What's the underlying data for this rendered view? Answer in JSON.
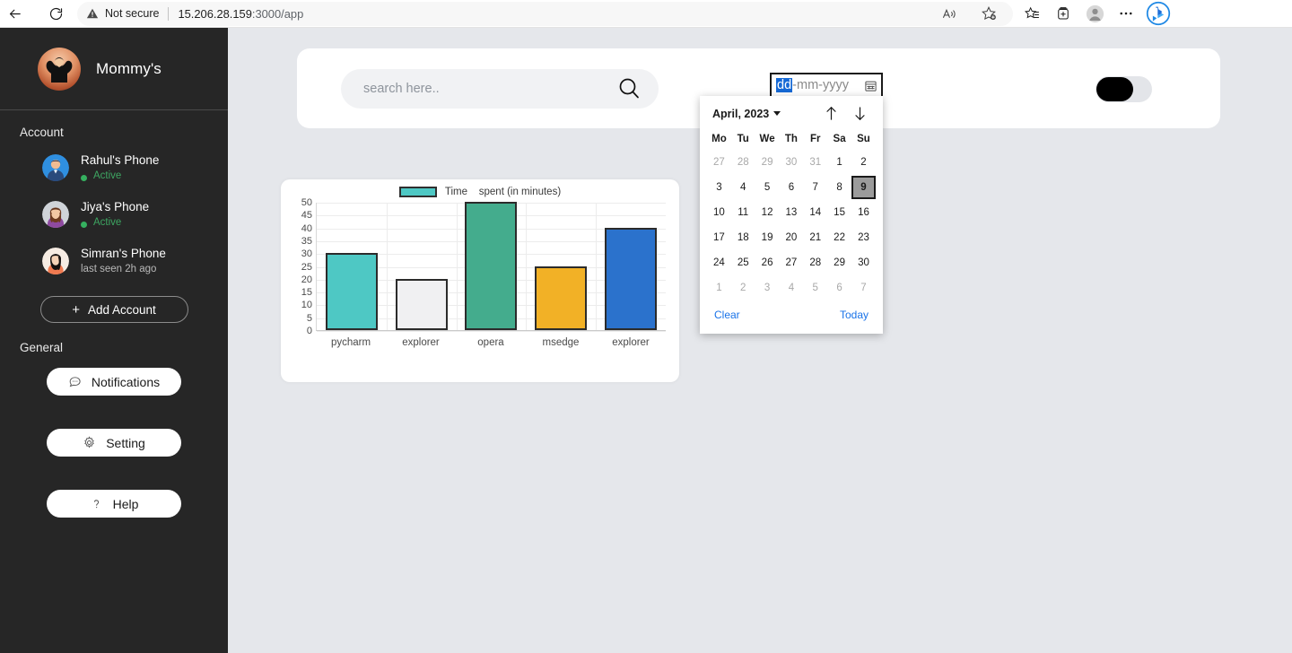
{
  "browser": {
    "back_label": "Back",
    "reload_label": "Refresh",
    "security_text": "Not secure",
    "url_host": "15.206.28.159",
    "url_path": ":3000/app",
    "icons": {
      "back": "back-arrow-icon",
      "reload": "reload-icon",
      "warning": "warning-triangle-icon",
      "read_aloud": "read-aloud-icon",
      "add_favorite": "add-favorite-icon",
      "favorites": "favorites-icon",
      "collections": "collections-icon",
      "profile": "profile-avatar-icon",
      "settings_more": "more-options-icon",
      "copilot": "bing-copilot-icon"
    }
  },
  "sidebar": {
    "brand_name": "Mommy's",
    "account_section_label": "Account",
    "accounts": [
      {
        "name": "Rahul's Phone",
        "status": "Active",
        "state": "active"
      },
      {
        "name": "Jiya's Phone",
        "status": "Active",
        "state": "active"
      },
      {
        "name": "Simran's Phone",
        "status": "last seen 2h ago",
        "state": "idle"
      }
    ],
    "add_account_label": "Add Account",
    "add_account_plus": "+",
    "general_section_label": "General",
    "general_items": [
      {
        "label": "Notifications",
        "icon": "chat-bubble-icon"
      },
      {
        "label": "Setting",
        "icon": "gear-icon"
      },
      {
        "label": "Help",
        "icon": "question-mark-icon"
      }
    ]
  },
  "topbar": {
    "search_placeholder": "search here..",
    "search_value": "",
    "date_input": {
      "segment_day": "dd",
      "separator1": "-",
      "segment_month": "mm",
      "separator2": "-",
      "segment_year": "yyyy",
      "calendar_icon": "calendar-icon"
    },
    "toggle_state": "off"
  },
  "datepicker": {
    "month_label": "April, 2023",
    "prev_label": "↑",
    "next_label": "↓",
    "day_headers": [
      "Mo",
      "Tu",
      "We",
      "Th",
      "Fr",
      "Sa",
      "Su"
    ],
    "weeks": [
      [
        {
          "d": "27",
          "m": true
        },
        {
          "d": "28",
          "m": true
        },
        {
          "d": "29",
          "m": true
        },
        {
          "d": "30",
          "m": true
        },
        {
          "d": "31",
          "m": true
        },
        {
          "d": "1",
          "m": false
        },
        {
          "d": "2",
          "m": false
        }
      ],
      [
        {
          "d": "3",
          "m": false
        },
        {
          "d": "4",
          "m": false
        },
        {
          "d": "5",
          "m": false
        },
        {
          "d": "6",
          "m": false
        },
        {
          "d": "7",
          "m": false
        },
        {
          "d": "8",
          "m": false
        },
        {
          "d": "9",
          "m": false,
          "sel": true
        }
      ],
      [
        {
          "d": "10",
          "m": false
        },
        {
          "d": "11",
          "m": false
        },
        {
          "d": "12",
          "m": false
        },
        {
          "d": "13",
          "m": false
        },
        {
          "d": "14",
          "m": false
        },
        {
          "d": "15",
          "m": false
        },
        {
          "d": "16",
          "m": false
        }
      ],
      [
        {
          "d": "17",
          "m": false
        },
        {
          "d": "18",
          "m": false
        },
        {
          "d": "19",
          "m": false
        },
        {
          "d": "20",
          "m": false
        },
        {
          "d": "21",
          "m": false
        },
        {
          "d": "22",
          "m": false
        },
        {
          "d": "23",
          "m": false
        }
      ],
      [
        {
          "d": "24",
          "m": false
        },
        {
          "d": "25",
          "m": false
        },
        {
          "d": "26",
          "m": false
        },
        {
          "d": "27",
          "m": false
        },
        {
          "d": "28",
          "m": false
        },
        {
          "d": "29",
          "m": false
        },
        {
          "d": "30",
          "m": false
        }
      ],
      [
        {
          "d": "1",
          "m": true
        },
        {
          "d": "2",
          "m": true
        },
        {
          "d": "3",
          "m": true
        },
        {
          "d": "4",
          "m": true
        },
        {
          "d": "5",
          "m": true
        },
        {
          "d": "6",
          "m": true
        },
        {
          "d": "7",
          "m": true
        }
      ]
    ],
    "clear_label": "Clear",
    "today_label": "Today"
  },
  "chart_data": {
    "type": "bar",
    "title": "",
    "legend": {
      "label": "Time    spent (in minutes)",
      "swatch_color": "#4ec8c4",
      "position": "top-center"
    },
    "categories": [
      "pycharm",
      "explorer",
      "opera",
      "msedge",
      "explorer"
    ],
    "values": [
      30,
      20,
      50,
      25,
      40
    ],
    "colors": [
      "#4ec8c4",
      "#f0f0f2",
      "#44ac8d",
      "#f2b126",
      "#2b72cc"
    ],
    "xlabel": "",
    "ylabel": "",
    "ylim": [
      0,
      50
    ],
    "yticks": [
      0,
      5,
      10,
      15,
      20,
      25,
      30,
      35,
      40,
      45,
      50
    ],
    "grid": true
  },
  "colors": {
    "sidebar_bg": "#262626",
    "page_bg": "#e5e7eb",
    "card_bg": "#ffffff",
    "accent_link": "#1a73e8",
    "active_green": "#35b05f",
    "date_select_blue": "#1669d6"
  }
}
